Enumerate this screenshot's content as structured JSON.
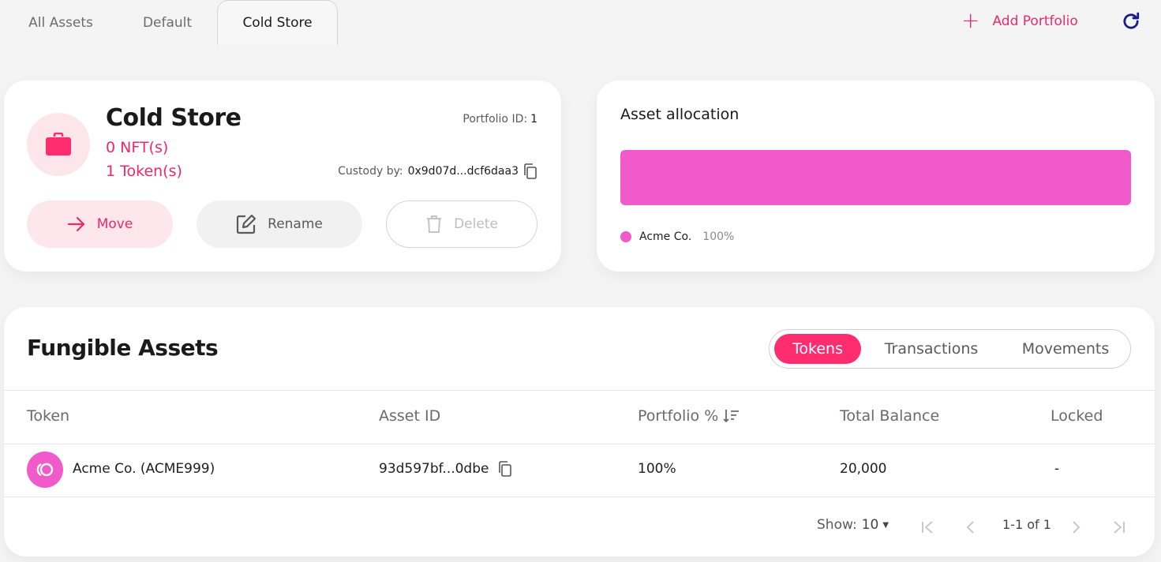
{
  "tabs": [
    {
      "label": "All Assets"
    },
    {
      "label": "Default"
    },
    {
      "label": "Cold Store"
    }
  ],
  "active_tab": "Cold Store",
  "header": {
    "add_portfolio_label": "Add Portfolio"
  },
  "portfolio": {
    "name": "Cold Store",
    "nft_count": "0 NFT(s)",
    "token_count": "1 Token(s)",
    "id_label": "Portfolio ID:",
    "id_value": "1",
    "custody_label": "Custody by:",
    "custody_value": "0x9d07d...dcf6daa3",
    "move_label": "Move",
    "rename_label": "Rename",
    "delete_label": "Delete"
  },
  "allocation": {
    "title": "Asset allocation",
    "items": [
      {
        "name": "Acme Co.",
        "percent": "100%",
        "color": "#f05acb"
      }
    ]
  },
  "fungible": {
    "title": "Fungible Assets",
    "segments": [
      "Tokens",
      "Transactions",
      "Movements"
    ],
    "active_segment": "Tokens",
    "columns": [
      "Token",
      "Asset ID",
      "Portfolio %",
      "Total Balance",
      "Locked"
    ],
    "rows": [
      {
        "token": "Acme Co. (ACME999)",
        "asset_id": "93d597bf...0dbe",
        "portfolio_pct": "100%",
        "total_balance": "20,000",
        "locked": "-"
      }
    ],
    "pagination": {
      "show_label": "Show:",
      "page_size": "10",
      "range": "1-1 of 1"
    }
  },
  "colors": {
    "accent": "#ec2a6b",
    "accent_strong": "#ff2d6f",
    "allocation": "#f05acb",
    "refresh": "#1a1a8c"
  }
}
